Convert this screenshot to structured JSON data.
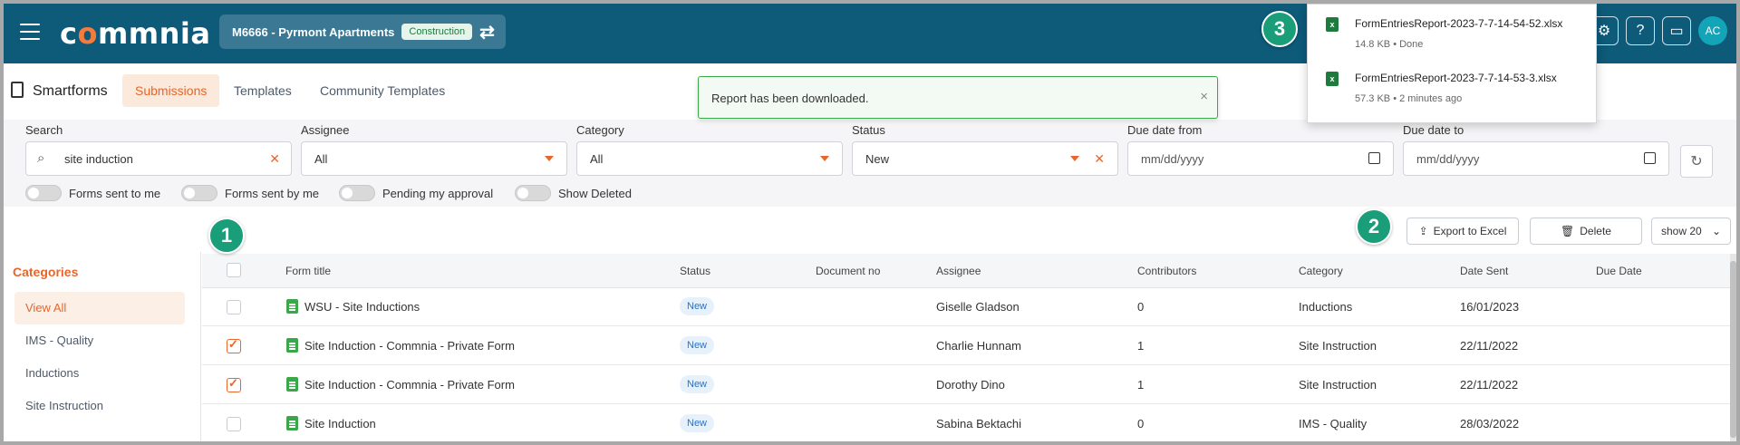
{
  "app": {
    "logo_text_pre": "c",
    "logo_text_o": "o",
    "logo_text_post": "mmnia",
    "project_name": "M6666 - Pyrmont Apartments",
    "project_badge": "Construction",
    "avatar_initials": "AC"
  },
  "subheader": {
    "title": "Smartforms",
    "tabs": [
      {
        "label": "Submissions",
        "active": true
      },
      {
        "label": "Templates",
        "active": false
      },
      {
        "label": "Community Templates",
        "active": false
      }
    ]
  },
  "filters": {
    "search_label": "Search",
    "search_value": "site induction",
    "assignee_label": "Assignee",
    "assignee_value": "All",
    "category_label": "Category",
    "category_value": "All",
    "status_label": "Status",
    "status_value": "New",
    "due_from_label": "Due date from",
    "due_from_placeholder": "mm/dd/yyyy",
    "due_to_label": "Due date to",
    "due_to_placeholder": "mm/dd/yyyy",
    "toggles": [
      "Forms sent to me",
      "Forms sent by me",
      "Pending my approval",
      "Show Deleted"
    ]
  },
  "actions": {
    "export_label": "Export to Excel",
    "delete_label": "Delete",
    "show_label": "show 20"
  },
  "markers": [
    "1",
    "2",
    "3"
  ],
  "categories": {
    "title": "Categories",
    "items": [
      {
        "label": "View All",
        "active": true
      },
      {
        "label": "IMS - Quality",
        "active": false
      },
      {
        "label": "Inductions",
        "active": false
      },
      {
        "label": "Site Instruction",
        "active": false
      }
    ]
  },
  "table": {
    "headers": [
      "Form title",
      "Status",
      "Document no",
      "Assignee",
      "Contributors",
      "Category",
      "Date Sent",
      "Due Date"
    ],
    "rows": [
      {
        "checked": false,
        "title": "WSU - Site Inductions",
        "status": "New",
        "doc": "",
        "assignee": "Giselle Gladson",
        "contributors": "0",
        "category": "Inductions",
        "date_sent": "16/01/2023",
        "due": ""
      },
      {
        "checked": true,
        "title": "Site Induction - Commnia - Private Form",
        "status": "New",
        "doc": "",
        "assignee": "Charlie Hunnam",
        "contributors": "1",
        "category": "Site Instruction",
        "date_sent": "22/11/2022",
        "due": ""
      },
      {
        "checked": true,
        "title": "Site Induction - Commnia - Private Form",
        "status": "New",
        "doc": "",
        "assignee": "Dorothy Dino",
        "contributors": "1",
        "category": "Site Instruction",
        "date_sent": "22/11/2022",
        "due": ""
      },
      {
        "checked": false,
        "title": "Site Induction",
        "status": "New",
        "doc": "",
        "assignee": "Sabina Bektachi",
        "contributors": "0",
        "category": "IMS - Quality",
        "date_sent": "28/03/2022",
        "due": ""
      }
    ]
  },
  "toast": {
    "message": "Report has been downloaded."
  },
  "downloads": {
    "items": [
      {
        "name": "FormEntriesReport-2023-7-7-14-54-52.xlsx",
        "meta": "14.8 KB • Done"
      },
      {
        "name": "FormEntriesReport-2023-7-7-14-53-3.xlsx",
        "meta": "57.3 KB • 2 minutes ago"
      }
    ]
  },
  "colors": {
    "topbar": "#0d5a79",
    "accent": "#e8662a",
    "marker": "#1a9e7a"
  }
}
